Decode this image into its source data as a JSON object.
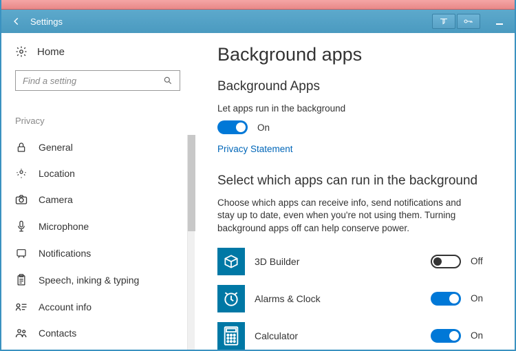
{
  "window": {
    "title": "Settings"
  },
  "sidebar": {
    "home": "Home",
    "search_placeholder": "Find a setting",
    "section": "Privacy",
    "items": [
      {
        "label": "General"
      },
      {
        "label": "Location"
      },
      {
        "label": "Camera"
      },
      {
        "label": "Microphone"
      },
      {
        "label": "Notifications"
      },
      {
        "label": "Speech, inking & typing"
      },
      {
        "label": "Account info"
      },
      {
        "label": "Contacts"
      }
    ]
  },
  "main": {
    "heading": "Background apps",
    "subheading1": "Background Apps",
    "run_bg_text": "Let apps run in the background",
    "master_toggle_state": "On",
    "privacy_link": "Privacy Statement",
    "subheading2": "Select which apps can run in the background",
    "description": "Choose which apps can receive info, send notifications and stay up to date, even when you're not using them. Turning background apps off can help conserve power.",
    "apps": [
      {
        "name": "3D Builder",
        "state": "Off"
      },
      {
        "name": "Alarms & Clock",
        "state": "On"
      },
      {
        "name": "Calculator",
        "state": "On"
      }
    ]
  }
}
